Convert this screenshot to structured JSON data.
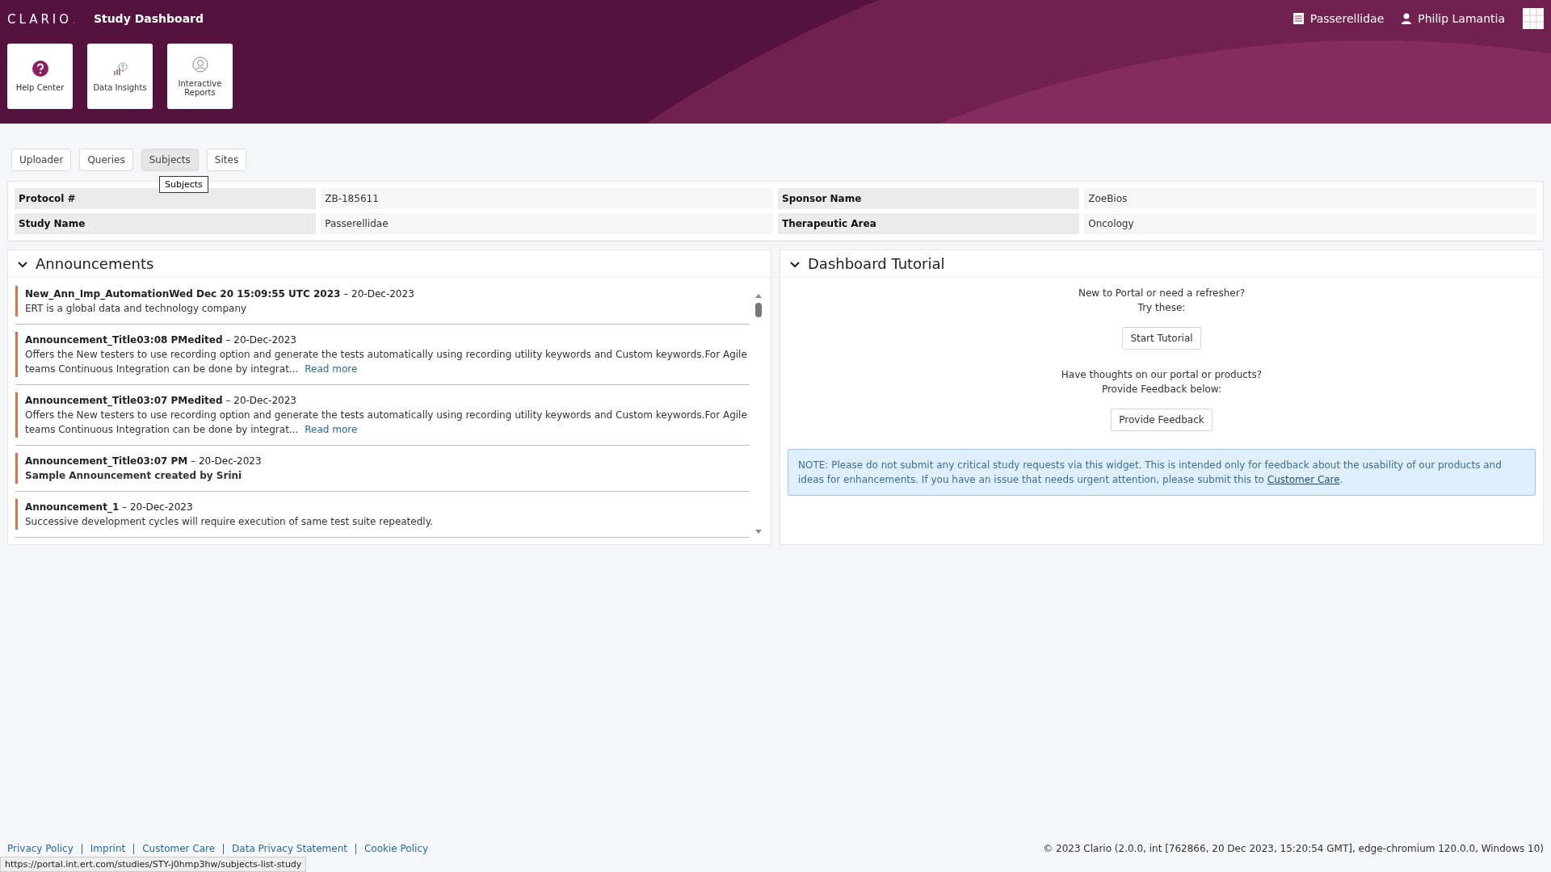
{
  "header": {
    "logo": "CLARIO",
    "logo_dot": ".",
    "title": "Study Dashboard",
    "study": "Passerellidae",
    "user": "Philip Lamantia"
  },
  "tiles": [
    {
      "kind": "help",
      "label": "Help Center"
    },
    {
      "kind": "insights",
      "label": "Data Insights"
    },
    {
      "kind": "reports",
      "label": "Interactive Reports"
    }
  ],
  "tabs": [
    {
      "label": "Uploader",
      "selected": false
    },
    {
      "label": "Queries",
      "selected": false
    },
    {
      "label": "Subjects",
      "selected": true
    },
    {
      "label": "Sites",
      "selected": false
    }
  ],
  "tooltip": "Subjects",
  "info": [
    {
      "label": "Protocol #",
      "value": "ZB-185611"
    },
    {
      "label": "Sponsor Name",
      "value": "ZoeBios"
    },
    {
      "label": "Study Name",
      "value": "Passerellidae"
    },
    {
      "label": "Therapeutic Area",
      "value": "Oncology"
    }
  ],
  "announcements": {
    "title": "Announcements",
    "expanded": true,
    "items": [
      {
        "title": "New_Ann_Imp_AutomationWed Dec 20 15:09:55 UTC 2023",
        "separator": "–",
        "date": "20-Dec-2023",
        "kind": "plain",
        "body": "ERT is a global data and technology company"
      },
      {
        "title": "Announcement_Title03:08 PMedited",
        "separator": "–",
        "date": "20-Dec-2023",
        "kind": "plain",
        "body": "Offers the New testers to use recording option and generate the tests automatically using recording utility keywords and Custom keywords.For Agile teams Continuous Integration can be done by integrat...",
        "link": "Read more"
      },
      {
        "title": "Announcement_Title03:07 PMedited",
        "separator": "–",
        "date": "20-Dec-2023",
        "kind": "plain",
        "body": "Offers the New testers to use recording option and generate the tests automatically using recording utility keywords and Custom keywords.For Agile teams Continuous Integration can be done by integrat...",
        "link": "Read more"
      },
      {
        "title": "Announcement_Title03:07 PM",
        "separator": "–",
        "date": "20-Dec-2023",
        "kind": "bold",
        "body": "Sample Announcement created by Srini"
      },
      {
        "title": "Announcement_1",
        "separator": "–",
        "date": "20-Dec-2023",
        "kind": "plain",
        "body": "Successive development cycles will require execution of same test suite repeatedly."
      }
    ]
  },
  "tutorial": {
    "title": "Dashboard Tutorial",
    "expanded": true,
    "intro": [
      "New to Portal or need a refresher?",
      "Try these:"
    ],
    "start_button": "Start Tutorial",
    "feedback_text": [
      "Have thoughts on our portal or products?",
      "Provide Feedback below:"
    ],
    "feedback_button": "Provide Feedback",
    "note": "NOTE: Please do not submit any critical study requests via this widget. This is intended only for feedback about the usability of our products and ideas for enhancements. If you have an issue that needs urgent attention, please submit this to",
    "note_link": "Customer Care",
    "note_end": "."
  },
  "footer": {
    "links": [
      "Privacy Policy",
      "Imprint",
      "Customer Care",
      "Data Privacy Statement",
      "Cookie Policy"
    ],
    "version": "© 2023 Clario (2.0.0, int [762866, 20 Dec 2023, 15:20:54 GMT], edge-chromium 120.0.0, Windows 10)"
  },
  "status_url": "https://portal.int.ert.com/studies/STY-j0hmp3hw/subjects-list-study"
}
